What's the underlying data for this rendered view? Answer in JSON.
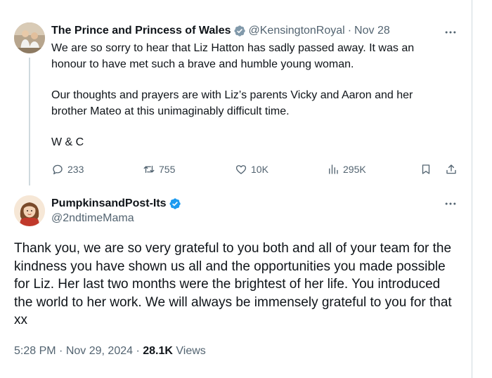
{
  "tweet1": {
    "author_name": "The Prince and Princess of Wales",
    "handle": "@KensingtonRoyal",
    "separator": "·",
    "date": "Nov 28",
    "paragraphs": [
      "We are so sorry to hear that Liz Hatton has sadly passed away. It was an honour to have met such a brave and humble young woman.",
      "Our thoughts and prayers are with Liz’s parents Vicky and Aaron and her brother Mateo at this unimaginably difficult time.",
      "W & C"
    ],
    "actions": {
      "replies": "233",
      "reposts": "755",
      "likes": "10K",
      "views": "295K"
    },
    "verified_badge_color": "#829aab"
  },
  "tweet2": {
    "author_name": "PumpkinsandPost-Its",
    "handle": "@2ndtimeMama",
    "text": "Thank you, we are so very grateful to you both and all of your team for the kindness you have shown us all and the opportunities you made possible for Liz. Her last two months were the brightest of her life. You introduced the world to her work. We will always be immensely grateful to you for that xx",
    "time": "5:28 PM",
    "separator": "·",
    "date": "Nov 29, 2024",
    "views_count": "28.1K",
    "views_label": "Views",
    "verified_badge_color": "#1d9bf0"
  },
  "icons": {
    "more": "more-icon",
    "reply": "reply-icon",
    "repost": "repost-icon",
    "like": "heart-icon",
    "views": "analytics-icon",
    "bookmark": "bookmark-icon",
    "share": "share-icon"
  },
  "colors": {
    "text": "#0f1419",
    "secondary": "#536471",
    "border": "#cfd9de"
  }
}
